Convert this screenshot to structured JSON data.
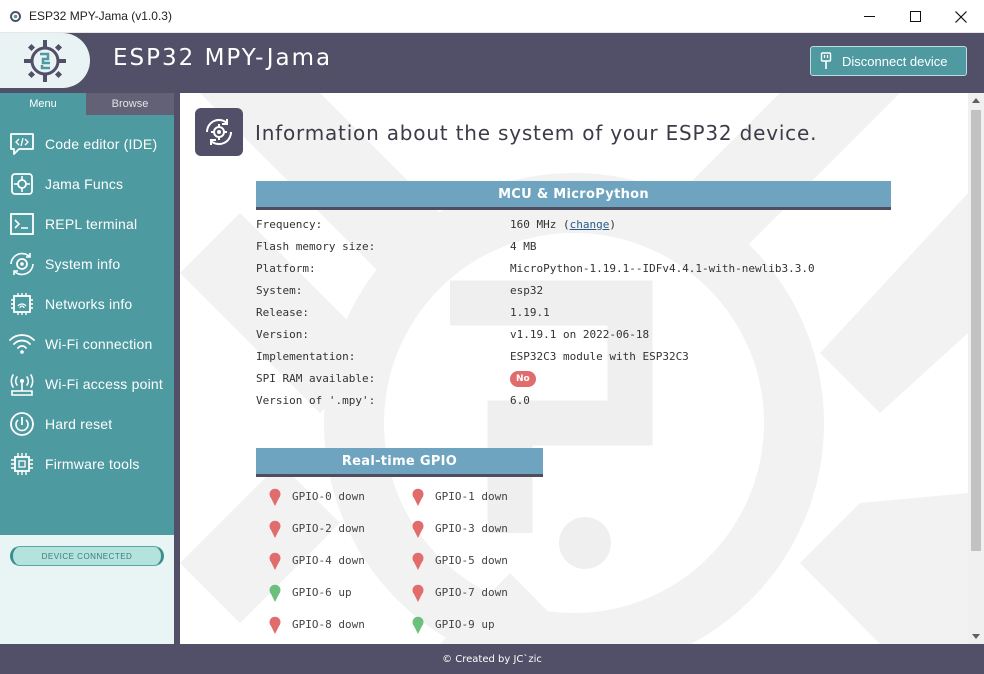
{
  "window": {
    "title": "ESP32 MPY-Jama (v1.0.3)"
  },
  "header": {
    "app_name": "ESP32 MPY-Jama",
    "disconnect_label": "Disconnect device"
  },
  "sidebar": {
    "tabs": [
      {
        "label": "Menu",
        "active": true
      },
      {
        "label": "Browse",
        "active": false
      }
    ],
    "items": [
      {
        "label": "Code editor (IDE)",
        "icon": "code-editor-icon"
      },
      {
        "label": "Jama Funcs",
        "icon": "jama-funcs-icon"
      },
      {
        "label": "REPL terminal",
        "icon": "terminal-icon"
      },
      {
        "label": "System info",
        "icon": "system-info-icon"
      },
      {
        "label": "Networks info",
        "icon": "network-chip-icon"
      },
      {
        "label": "Wi-Fi connection",
        "icon": "wifi-icon"
      },
      {
        "label": "Wi-Fi access point",
        "icon": "access-point-icon"
      },
      {
        "label": "Hard reset",
        "icon": "power-icon"
      },
      {
        "label": "Firmware tools",
        "icon": "chip-icon"
      }
    ],
    "status_badge": "DEVICE CONNECTED"
  },
  "main": {
    "page_title": "Information about the system of your ESP32 device.",
    "mcu_section": {
      "heading": "MCU & MicroPython",
      "rows": [
        {
          "key": "Frequency:",
          "value": "160 MHz (",
          "link": "change",
          "suffix": ")"
        },
        {
          "key": "Flash memory size:",
          "value": "4 MB"
        },
        {
          "key": "Platform:",
          "value": "MicroPython-1.19.1--IDFv4.4.1-with-newlib3.3.0"
        },
        {
          "key": "System:",
          "value": "esp32"
        },
        {
          "key": "Release:",
          "value": "1.19.1"
        },
        {
          "key": "Version:",
          "value": "v1.19.1 on 2022-06-18"
        },
        {
          "key": "Implementation:",
          "value": "ESP32C3 module with ESP32C3"
        },
        {
          "key": "SPI RAM available:",
          "badge": "No"
        },
        {
          "key": "Version of '.mpy':",
          "value": "6.0"
        }
      ]
    },
    "gpio_section": {
      "heading": "Real-time GPIO",
      "pins": [
        {
          "label": "GPIO-0 down",
          "state": "down"
        },
        {
          "label": "GPIO-1 down",
          "state": "down"
        },
        {
          "label": "GPIO-2 down",
          "state": "down"
        },
        {
          "label": "GPIO-3 down",
          "state": "down"
        },
        {
          "label": "GPIO-4 down",
          "state": "down"
        },
        {
          "label": "GPIO-5 down",
          "state": "down"
        },
        {
          "label": "GPIO-6 up",
          "state": "up"
        },
        {
          "label": "GPIO-7 down",
          "state": "down"
        },
        {
          "label": "GPIO-8 down",
          "state": "down"
        },
        {
          "label": "GPIO-9 up",
          "state": "up"
        }
      ]
    }
  },
  "footer": {
    "credit": "© Created by JC`zic"
  },
  "colors": {
    "header_bg": "#515068",
    "accent_teal": "#4e9aa1",
    "section_head": "#6ea4bf",
    "pin_down": "#e06c6c",
    "pin_up": "#6cbf7c"
  }
}
